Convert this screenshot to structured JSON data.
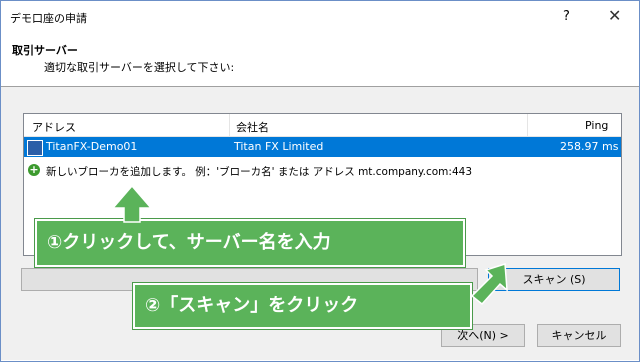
{
  "window": {
    "title": "デモ口座の申請",
    "help_label": "?",
    "close_label": "✕"
  },
  "header": {
    "heading": "取引サーバー",
    "subheading": "適切な取引サーバーを選択して下さい:"
  },
  "list": {
    "columns": [
      "アドレス",
      "会社名",
      "Ping"
    ],
    "selected_row": {
      "address": "TitanFX-Demo01",
      "company": "Titan FX Limited",
      "ping": "258.97 ms"
    },
    "add_row": "新しいブローカを追加します。 例：'ブローカ名' または アドレス mt.company.com:443"
  },
  "buttons": {
    "scan": "スキャン (S)",
    "next": "次へ(N) >",
    "cancel": "キャンセル"
  },
  "callouts": {
    "step1": "①クリックして、サーバー名を入力",
    "step2": "②「スキャン」をクリック"
  },
  "colors": {
    "callout_green": "#5bb35a",
    "selection_blue": "#0078d7"
  }
}
